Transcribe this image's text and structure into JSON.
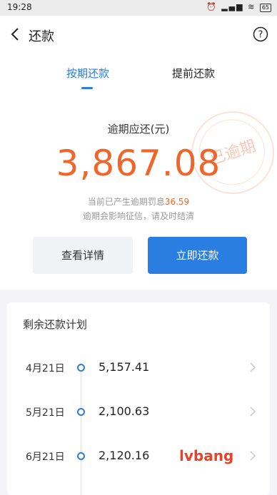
{
  "status_bar": {
    "time": "19:28",
    "battery": "65"
  },
  "header": {
    "title": "还款"
  },
  "tabs": [
    {
      "label": "按期还款",
      "active": true
    },
    {
      "label": "提前还款",
      "active": false
    }
  ],
  "overdue": {
    "label": "逾期应还(元)",
    "amount": "3,867.08",
    "penalty_prefix": "当前已产生逾期罚息",
    "penalty_amount": "36.59",
    "credit_note": "逾期会影响征信，请及时结清",
    "stamp_text": "已逾期"
  },
  "actions": {
    "detail_label": "查看详情",
    "repay_label": "立即还款"
  },
  "plan": {
    "title": "剩余还款计划",
    "items": [
      {
        "date": "4月21日",
        "amount": "5,157.41"
      },
      {
        "date": "5月21日",
        "amount": "2,100.63"
      },
      {
        "date": "6月21日",
        "amount": "2,120.16"
      }
    ]
  },
  "watermark": "lvbang",
  "colors": {
    "accent": "#2a7de1",
    "overdue": "#f0662a"
  }
}
